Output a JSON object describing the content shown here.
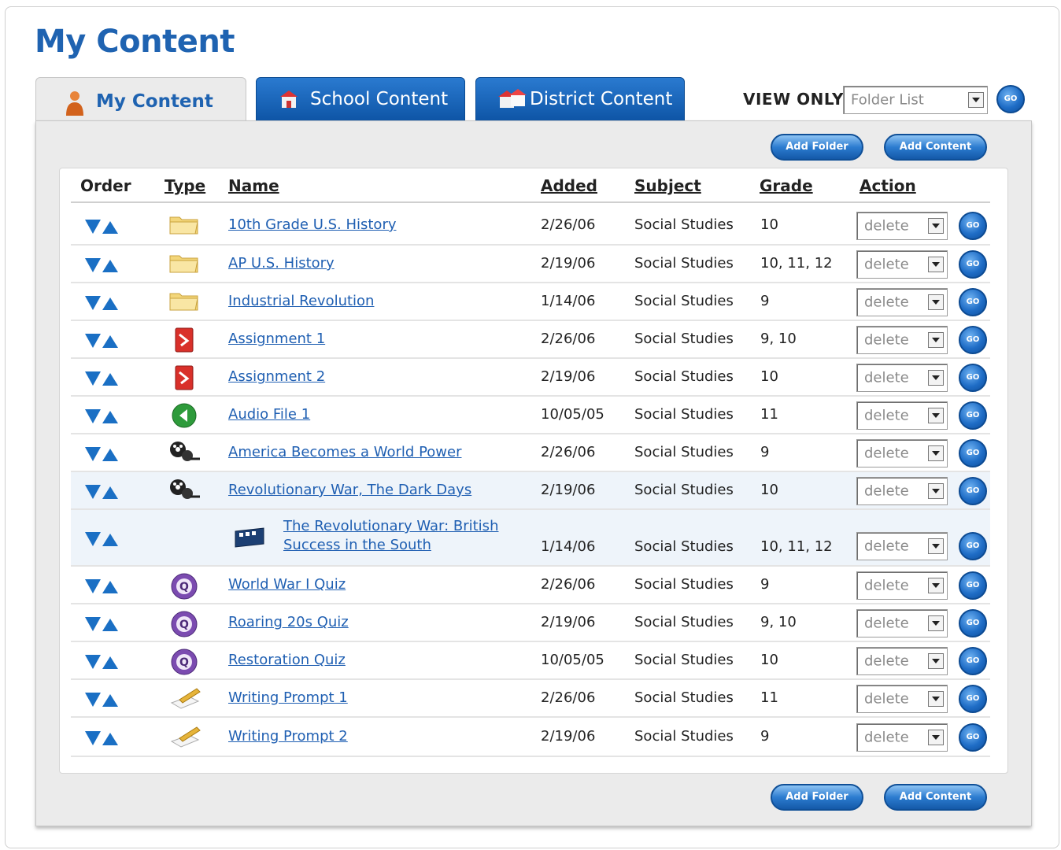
{
  "page": {
    "title": "My Content"
  },
  "tabs": [
    {
      "label": "My Content",
      "icon": "person-icon",
      "active": true
    },
    {
      "label": "School Content",
      "icon": "school-icon",
      "active": false
    },
    {
      "label": "District Content",
      "icon": "district-icon",
      "active": false
    }
  ],
  "view_only": {
    "label": "VIEW ONLY",
    "selected": "Folder List",
    "go_label": "GO"
  },
  "toolbar": {
    "add_folder": "Add Folder",
    "add_content": "Add Content"
  },
  "table": {
    "headers": {
      "order": "Order",
      "type": "Type",
      "name": "Name",
      "added": "Added",
      "subject": "Subject",
      "grade": "Grade",
      "action": "Action"
    },
    "rows": [
      {
        "type": "folder-icon",
        "name": "10th Grade U.S. History",
        "added": "2/26/06",
        "subject": "Social Studies",
        "grade": "10",
        "action": "delete"
      },
      {
        "type": "folder-icon",
        "name": "AP U.S. History",
        "added": "2/19/06",
        "subject": "Social Studies",
        "grade": "10, 11, 12",
        "action": "delete"
      },
      {
        "type": "folder-icon",
        "name": "Industrial Revolution",
        "added": "1/14/06",
        "subject": "Social Studies",
        "grade": "9",
        "action": "delete"
      },
      {
        "type": "assignment-icon",
        "name": "Assignment 1",
        "added": "2/26/06",
        "subject": "Social Studies",
        "grade": "9, 10",
        "action": "delete"
      },
      {
        "type": "assignment-icon",
        "name": "Assignment 2",
        "added": "2/19/06",
        "subject": "Social Studies",
        "grade": "10",
        "action": "delete"
      },
      {
        "type": "audio-icon",
        "name": "Audio File 1",
        "added": "10/05/05",
        "subject": "Social Studies",
        "grade": "11",
        "action": "delete"
      },
      {
        "type": "video-icon",
        "name": "America Becomes a World Power",
        "added": "2/26/06",
        "subject": "Social Studies",
        "grade": "9",
        "action": "delete"
      },
      {
        "type": "video-icon",
        "name": "Revolutionary War, The Dark Days",
        "added": "2/19/06",
        "subject": "Social Studies",
        "grade": "10",
        "action": "delete"
      },
      {
        "type": "clip-icon",
        "name": "The Revolutionary War: British",
        "name2": "Success in the South",
        "added": "1/14/06",
        "subject": "Social Studies",
        "grade": "10, 11, 12",
        "action": "delete"
      },
      {
        "type": "quiz-icon",
        "name": "World War I Quiz",
        "added": "2/26/06",
        "subject": "Social Studies",
        "grade": "9",
        "action": "delete"
      },
      {
        "type": "quiz-icon",
        "name": "Roaring 20s Quiz",
        "added": "2/19/06",
        "subject": "Social Studies",
        "grade": "9, 10",
        "action": "delete"
      },
      {
        "type": "quiz-icon",
        "name": "Restoration Quiz",
        "added": "10/05/05",
        "subject": "Social Studies",
        "grade": "10",
        "action": "delete"
      },
      {
        "type": "writing-prompt-icon",
        "name": "Writing Prompt 1",
        "added": "2/26/06",
        "subject": "Social Studies",
        "grade": "11",
        "action": "delete"
      },
      {
        "type": "writing-prompt-icon",
        "name": "Writing Prompt 2",
        "added": "2/19/06",
        "subject": "Social Studies",
        "grade": "9",
        "action": "delete"
      }
    ]
  },
  "colors": {
    "brand_blue": "#1f63b1",
    "tab_blue": "#1b66bd",
    "link": "#1f5fb2",
    "panel": "#ebebeb"
  }
}
